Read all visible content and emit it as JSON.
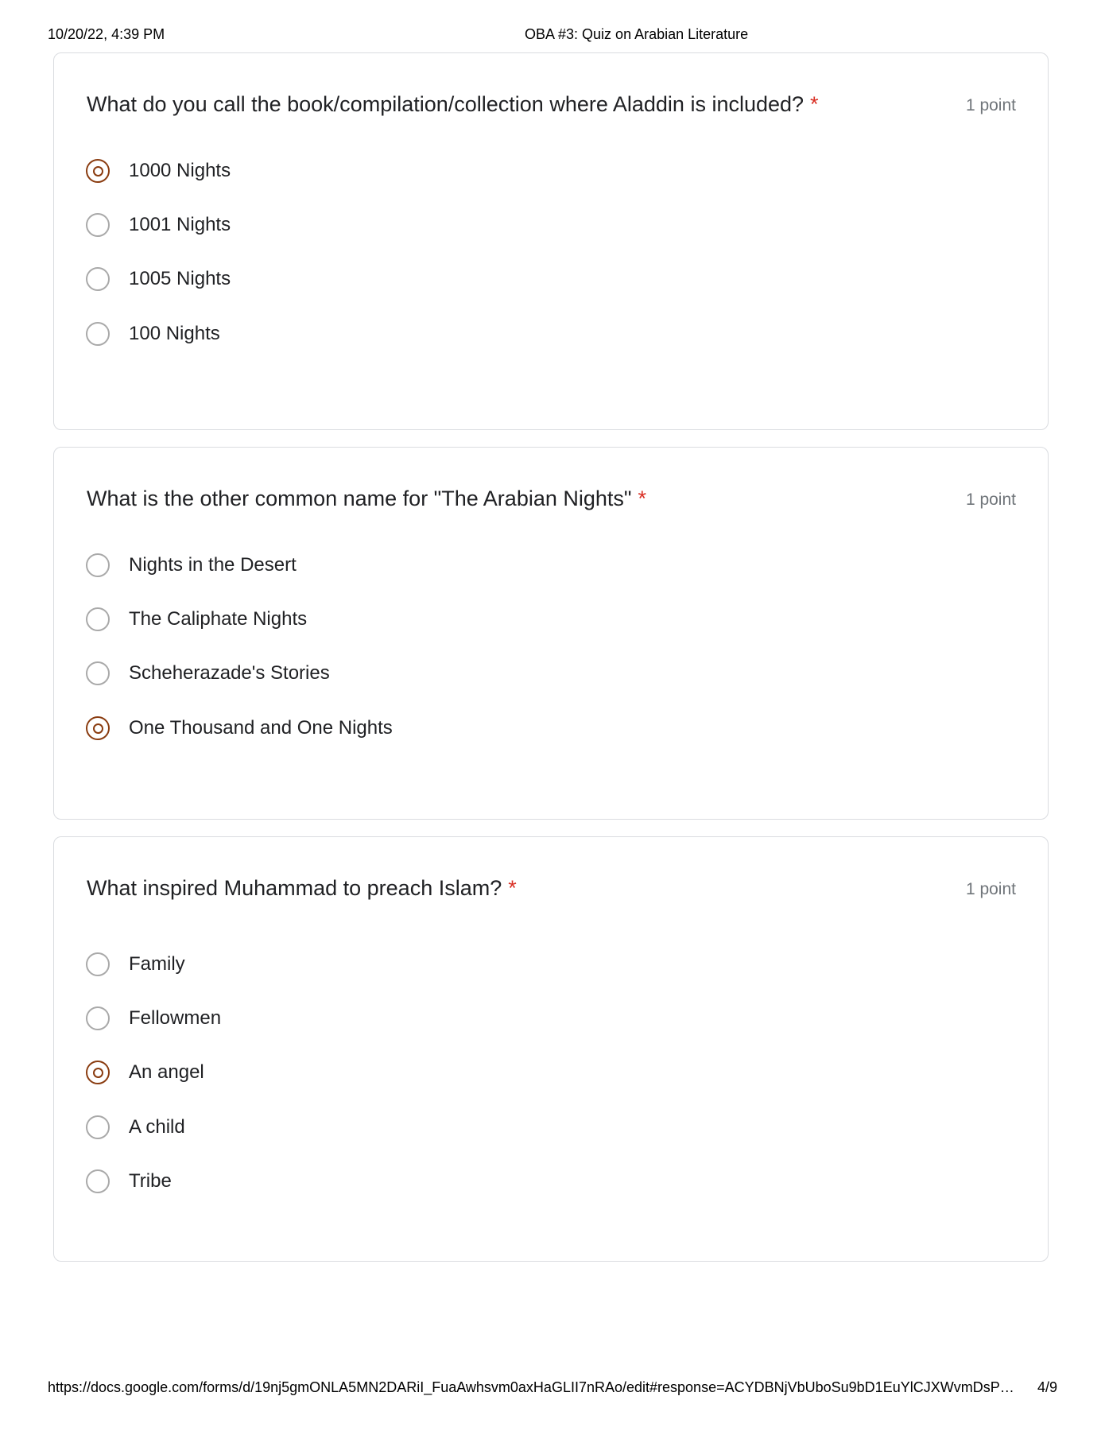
{
  "print_header": {
    "datetime": "10/20/22, 4:39 PM",
    "title": "OBA #3: Quiz on Arabian Literature"
  },
  "questions": [
    {
      "title": "What do you call the book/compilation/collection where Aladdin is included?",
      "required_marker": "*",
      "points": "1 point",
      "options": [
        {
          "label": "1000 Nights",
          "selected": true
        },
        {
          "label": "1001 Nights",
          "selected": false
        },
        {
          "label": "1005 Nights",
          "selected": false
        },
        {
          "label": "100 Nights",
          "selected": false
        }
      ]
    },
    {
      "title": "What is the other common name for \"The Arabian Nights\"",
      "required_marker": "*",
      "points": "1 point",
      "options": [
        {
          "label": "Nights in the Desert",
          "selected": false
        },
        {
          "label": "The Caliphate Nights",
          "selected": false
        },
        {
          "label": "Scheherazade's Stories",
          "selected": false
        },
        {
          "label": "One Thousand and One Nights",
          "selected": true
        }
      ]
    },
    {
      "title": "What inspired Muhammad to preach Islam?",
      "required_marker": "*",
      "points": "1 point",
      "options": [
        {
          "label": "Family",
          "selected": false
        },
        {
          "label": "Fellowmen",
          "selected": false
        },
        {
          "label": "An angel",
          "selected": true
        },
        {
          "label": "A child",
          "selected": false
        },
        {
          "label": "Tribe",
          "selected": false
        }
      ]
    }
  ],
  "print_footer": {
    "url": "https://docs.google.com/forms/d/19nj5gmONLA5MN2DARiI_FuaAwhsvm0axHaGLII7nRAo/edit#response=ACYDBNjVbUboSu9bD1EuYlCJXWvmDsP…",
    "page": "4/9"
  },
  "colors": {
    "required_star": "#d93025",
    "selected_radio": "#8a3c10",
    "card_border": "#dadce0"
  }
}
